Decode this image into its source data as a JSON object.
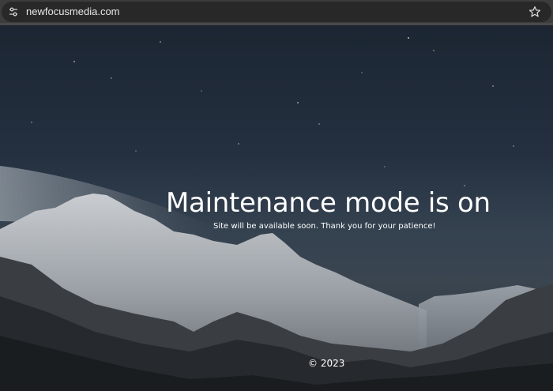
{
  "browser": {
    "url": "newfocusmedia.com",
    "site_info_icon": "tune-icon",
    "bookmark_icon": "star-outline-icon"
  },
  "hero": {
    "background": "mountain-night-sky",
    "headline": "Maintenance mode is on",
    "subline": "Site will be available soon. Thank you for your patience!"
  },
  "footer": {
    "copyright": "© 2023"
  },
  "colors": {
    "toolbar": "#3c3c3c",
    "address_bar": "#282828",
    "text": "#ffffff",
    "sky_top": "#1c2633",
    "sky_mid": "#34414f"
  }
}
